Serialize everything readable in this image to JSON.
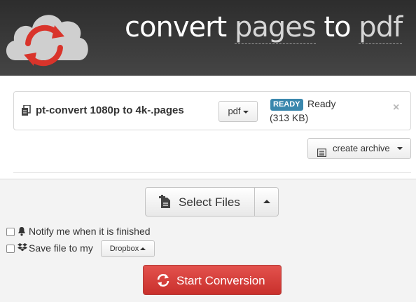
{
  "header": {
    "brand_prefix": "convert ",
    "brand_from": "pages",
    "brand_mid": " to ",
    "brand_to": "pdf"
  },
  "file": {
    "name": "pt-convert 1080p to 4k-.pages",
    "format": "pdf",
    "badge": "READY",
    "status": "Ready",
    "size": "(313 KB)",
    "close": "×"
  },
  "archive": {
    "label": "create archive"
  },
  "select": {
    "label": "Select Files"
  },
  "options": {
    "notify_label": "Notify me when it is finished",
    "save_label": "Save file to my",
    "dropbox_label": "Dropbox"
  },
  "start": {
    "label": "Start Conversion"
  },
  "colors": {
    "header_bg": "#333333",
    "badge": "#3a87ad",
    "start_button": "#d9534f",
    "logo_cloud": "#cfcfcf",
    "logo_arrows": "#d9342b"
  },
  "icons": {
    "logo": "cloud-convert-logo",
    "file": "file-copy-icon",
    "archive": "archive-icon",
    "select": "file-plus-icon",
    "notify": "bell-icon",
    "dropbox": "dropbox-icon",
    "start": "refresh-icon"
  }
}
